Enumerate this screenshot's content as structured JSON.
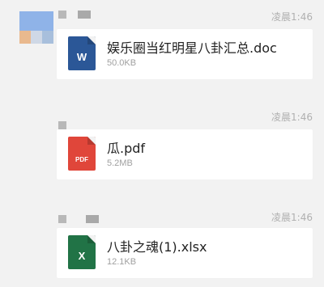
{
  "colors": {
    "background": "#f2f2f2",
    "card": "#ffffff",
    "doc_icon": "#2b5797",
    "pdf_icon": "#e0463a",
    "xlsx_icon": "#217346",
    "time_text": "#b0b0b0"
  },
  "messages": [
    {
      "time": "凌晨1:46",
      "file": {
        "name": "娱乐圈当红明星八卦汇总.doc",
        "size": "50.0KB",
        "type": "doc",
        "icon_label": "W",
        "icon": "word-document-icon"
      }
    },
    {
      "time": "凌晨1:46",
      "file": {
        "name": "瓜.pdf",
        "size": "5.2MB",
        "type": "pdf",
        "icon_label": "PDF",
        "icon": "pdf-document-icon"
      }
    },
    {
      "time": "凌晨1:46",
      "file": {
        "name": "八卦之魂(1).xlsx",
        "size": "12.1KB",
        "type": "xlsx",
        "icon_label": "X",
        "icon": "excel-document-icon"
      }
    }
  ]
}
